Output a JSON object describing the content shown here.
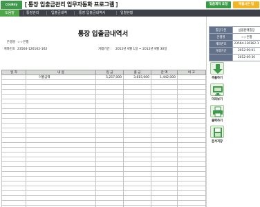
{
  "header": {
    "logo": "coukey",
    "title": "[ 통장 입출금관리 업무자동화 프로그램 ]",
    "request_button": "맞춤제작 요청",
    "license_button": "액셀시은 팁"
  },
  "tabs": [
    {
      "label": "도움말",
      "active": true
    },
    {
      "label": "통장관리",
      "active": false
    },
    {
      "label": "입출금내역",
      "active": false
    },
    {
      "label": "통장 입출금내역서",
      "active": false
    },
    {
      "label": "일별현황",
      "active": false
    }
  ],
  "document": {
    "title": "통장 입출금내역서",
    "bank_label": "은행명",
    "bank_value": "☆☆은행",
    "account_label": "계좌번호",
    "account_value": "23564-126162-162",
    "period_label": "거래기간 :",
    "period_value": "2012년 9월 1일 ~ 2012년 9월 30일"
  },
  "table": {
    "headers": [
      "일 자",
      "내 용",
      "입 금",
      "출 금",
      "잔 액",
      "비 고"
    ],
    "rows": [
      [
        "",
        "이월금액",
        "5,257,000",
        "3,815,000",
        "1,442,000",
        ""
      ]
    ],
    "empty_rows": 28
  },
  "summary": {
    "rows": [
      {
        "key": "통장구분",
        "value": "상품판매통장"
      },
      {
        "key": "은행명",
        "value": "☆☆은행"
      },
      {
        "key": "계좌번호",
        "value": "23564-126162-1"
      },
      {
        "key": "거래기간",
        "value": "2012-09-01"
      },
      {
        "key": "",
        "value": "2012-09-30"
      }
    ]
  },
  "side_buttons": [
    {
      "label": "추출하기",
      "icon": "extract-icon"
    },
    {
      "label": "미리보기",
      "icon": "preview-icon"
    },
    {
      "label": "출력하기",
      "icon": "print-icon"
    },
    {
      "label": "문서저장",
      "icon": "save-icon"
    }
  ],
  "colors": {
    "accent_green": "#4fa548",
    "tab_bar": "#3d4047",
    "header_request": "#3a9a45",
    "header_license": "#f0b627",
    "summary_key_bg": "#64718a"
  }
}
